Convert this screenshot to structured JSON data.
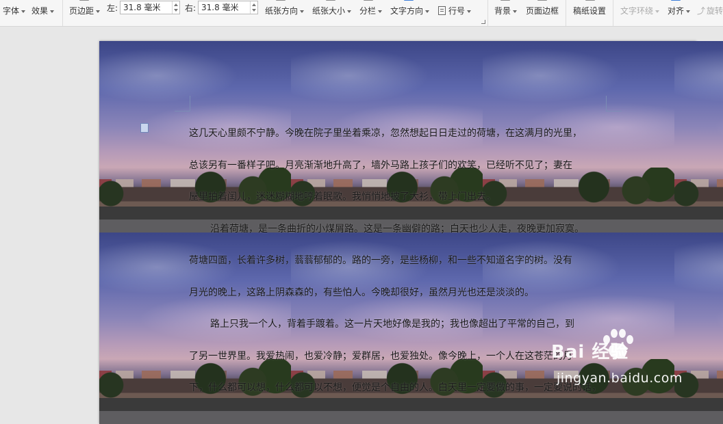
{
  "ribbon": {
    "font_label": "字体",
    "effect_label": "效果",
    "margin_label": "页边距",
    "left_label": "左:",
    "left_value": "31.8 毫米",
    "right_label": "右:",
    "right_value": "31.8 毫米",
    "orientation_label": "纸张方向",
    "size_label": "纸张大小",
    "columns_label": "分栏",
    "text_direction_label": "文字方向",
    "line_numbers_label": "行号",
    "background_label": "背景",
    "page_border_label": "页面边框",
    "manuscript_label": "稿纸设置",
    "text_wrap_label": "文字环绕",
    "align_label": "对齐",
    "rotate_label": "旋转",
    "icons": [
      "font-icon",
      "effect-icon",
      "margin-icon",
      "orientation-icon",
      "size-icon",
      "columns-icon",
      "text-direction-icon",
      "line-numbers-icon",
      "background-icon",
      "page-border-icon",
      "manuscript-icon",
      "text-wrap-icon",
      "align-icon",
      "rotate-icon"
    ]
  },
  "document": {
    "lines": [
      "这几天心里颇不宁静。今晚在院子里坐着乘凉，忽然想起日日走过的荷塘，在这满月的光里，",
      "总该另有一番样子吧。月亮渐渐地升高了，墙外马路上孩子们的欢笑，已经听不见了；妻在",
      "屋里拍着闰儿，迷迷糊糊地哼着眠歌。我悄悄地披了大衫，带上门出去。",
      "沿着荷塘，是一条曲折的小煤屑路。这是一条幽僻的路；白天也少人走，夜晚更加寂寞。",
      "荷塘四面，长着许多树，蓊蓊郁郁的。路的一旁，是些杨柳，和一些不知道名字的树。没有",
      "月光的晚上，这路上阴森森的，有些怕人。今晚却很好，虽然月光也还是淡淡的。",
      "路上只我一个人，背着手踱着。这一片天地好像是我的；我也像超出了平常的自己，到",
      "了另一世界里。我爱热闹，也爱冷静；爱群居，也爱独处。像今晚上，一个人在这苍茫的月",
      "下，什么都可以想，什么都可以不想，便觉是个自由的人。白天里一定要做的事，一定要说的话，"
    ],
    "indented_lines": [
      3,
      6
    ]
  },
  "watermark": {
    "brand": "Bai 经验",
    "url": "jingyan.baidu.com"
  },
  "colors": {
    "ribbon_bg": "#f6f6f6",
    "workspace_bg": "#e7e7e7",
    "accent_blue": "#3b7dd8"
  }
}
